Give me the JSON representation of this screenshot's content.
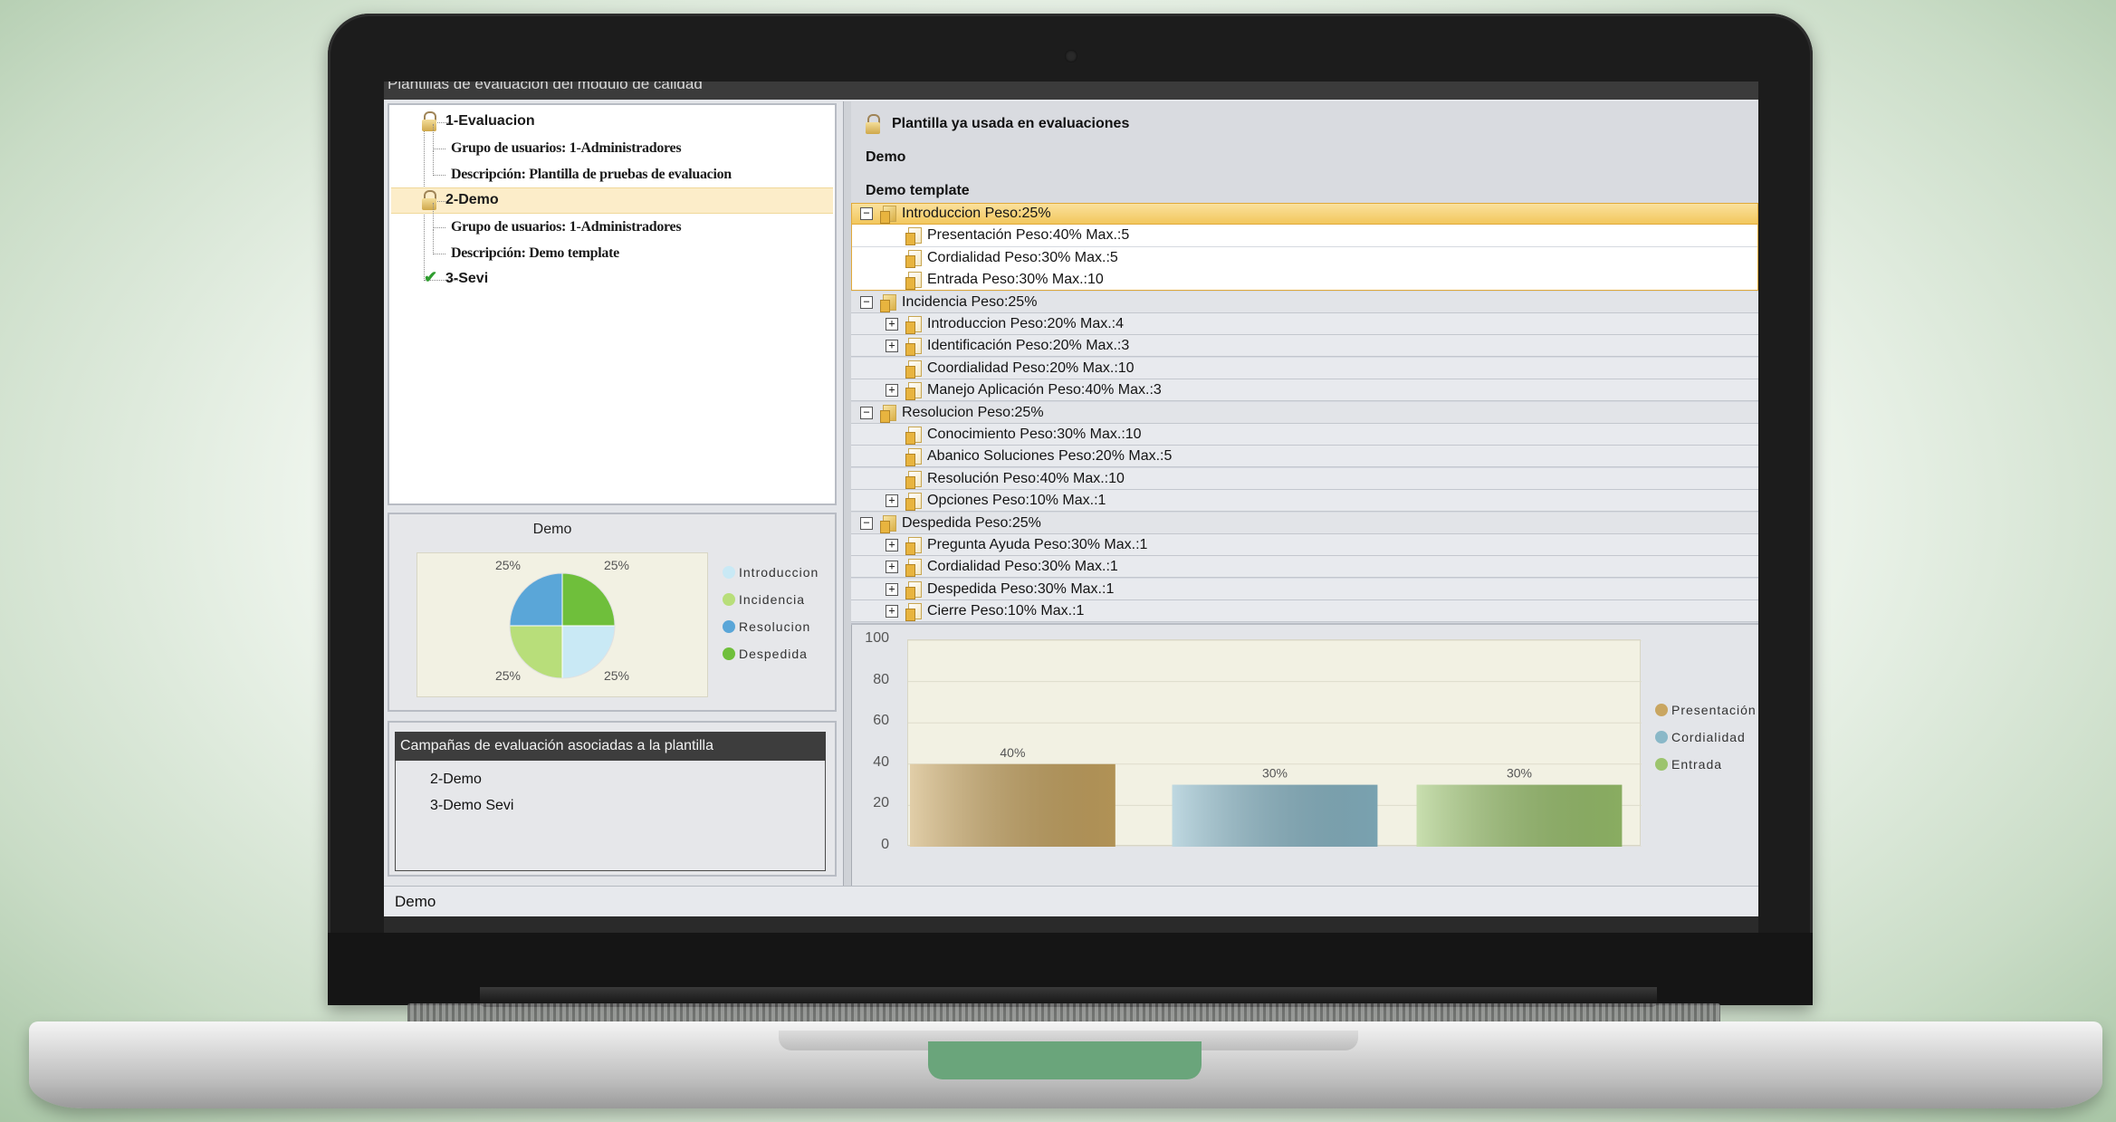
{
  "window": {
    "title": "Plantillas de evaluación del módulo de calidad"
  },
  "tree": [
    {
      "label": "1-Evaluacion",
      "icon": "lock-icon",
      "children": [
        "Grupo de usuarios: 1-Administradores",
        "Descripción: Plantilla de pruebas de evaluacion"
      ]
    },
    {
      "label": "2-Demo",
      "icon": "lock-icon",
      "selected": true,
      "children": [
        "Grupo de usuarios: 1-Administradores",
        "Descripción: Demo template"
      ]
    },
    {
      "label": "3-Sevi",
      "icon": "check-icon",
      "children": []
    }
  ],
  "pie": {
    "chart_data": {
      "type": "pie",
      "title": "Demo",
      "labels": [
        "Introduccion",
        "Incidencia",
        "Resolucion",
        "Despedida"
      ],
      "values": [
        25,
        25,
        25,
        25
      ],
      "value_labels": [
        "25%",
        "25%",
        "25%",
        "25%"
      ],
      "colors": [
        "#c9e9f5",
        "#b8de7a",
        "#5aa6d8",
        "#6fbf3b"
      ],
      "legend_position": "right"
    }
  },
  "campaigns": {
    "header": "Campañas de evaluación asociadas a la plantilla",
    "items": [
      "2-Demo",
      "3-Demo Sevi"
    ]
  },
  "detail": {
    "lock_notice": "Plantilla ya usada en evaluaciones",
    "name": "Demo",
    "description": "Demo template"
  },
  "grid": [
    {
      "type": "cat",
      "expand": "−",
      "label": "Introduccion Peso:25%",
      "selected": true
    },
    {
      "type": "item",
      "label": "Presentación  Peso:40%  Max.:5",
      "white": true
    },
    {
      "type": "item",
      "label": "Cordialidad  Peso:30%  Max.:5",
      "white": true
    },
    {
      "type": "item",
      "label": "Entrada  Peso:30%  Max.:10",
      "white": true
    },
    {
      "type": "cat",
      "expand": "−",
      "label": "Incidencia Peso:25%"
    },
    {
      "type": "item",
      "expand": "+",
      "label": "Introduccion  Peso:20%  Max.:4"
    },
    {
      "type": "item",
      "expand": "+",
      "label": "Identificación  Peso:20%  Max.:3"
    },
    {
      "type": "item",
      "label": "Coordialidad  Peso:20%  Max.:10"
    },
    {
      "type": "item",
      "expand": "+",
      "label": "Manejo Aplicación  Peso:40%  Max.:3"
    },
    {
      "type": "cat",
      "expand": "−",
      "label": "Resolucion Peso:25%"
    },
    {
      "type": "item",
      "label": "Conocimiento  Peso:30%  Max.:10"
    },
    {
      "type": "item",
      "label": "Abanico Soluciones  Peso:20%  Max.:5"
    },
    {
      "type": "item",
      "label": "Resolución  Peso:40%  Max.:10"
    },
    {
      "type": "item",
      "expand": "+",
      "label": "Opciones  Peso:10%  Max.:1"
    },
    {
      "type": "cat",
      "expand": "−",
      "label": "Despedida Peso:25%"
    },
    {
      "type": "item",
      "expand": "+",
      "label": "Pregunta Ayuda  Peso:30%  Max.:1"
    },
    {
      "type": "item",
      "expand": "+",
      "label": "Cordialidad  Peso:30%  Max.:1"
    },
    {
      "type": "item",
      "expand": "+",
      "label": "Despedida  Peso:30%  Max.:1"
    },
    {
      "type": "item",
      "expand": "+",
      "label": "Cierre  Peso:10%  Max.:1"
    }
  ],
  "bar": {
    "chart_data": {
      "type": "bar",
      "categories": [
        "Presentación",
        "Cordialidad",
        "Entrada"
      ],
      "values": [
        40,
        30,
        30
      ],
      "value_labels": [
        "40%",
        "30%",
        "30%"
      ],
      "ylim": [
        0,
        100
      ],
      "yticks": [
        0,
        20,
        40,
        60,
        80,
        100
      ],
      "colors": [
        "#c9a661",
        "#8ab8c8",
        "#9cc46e"
      ],
      "legend_position": "right",
      "grid": true
    }
  },
  "status": {
    "text": "Demo"
  }
}
